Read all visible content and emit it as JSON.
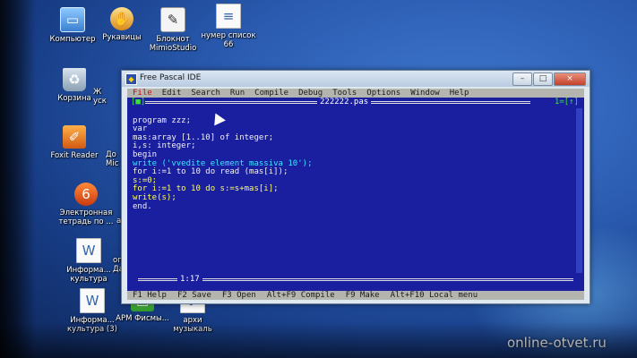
{
  "desktop": {
    "icons": [
      {
        "label": "Компьютер",
        "icon": "computer-icon"
      },
      {
        "label": "Рукавицы",
        "icon": "gloves-icon"
      },
      {
        "label": "Блокнот MimioStudio",
        "icon": "notepad-icon"
      },
      {
        "label": "нумер список 66",
        "icon": "document-icon"
      },
      {
        "label": "Корзина",
        "icon": "recycle-bin-icon"
      },
      {
        "label": "Ж",
        "icon": "partial-icon"
      },
      {
        "label": "уск",
        "icon": "partial-icon"
      },
      {
        "label": "Foxit Reader",
        "icon": "foxit-icon"
      },
      {
        "label": "До",
        "icon": "partial-icon"
      },
      {
        "label": "Mic",
        "icon": "partial-icon"
      },
      {
        "label": "Электронная тетрадь по ...",
        "icon": "ejournal-icon"
      },
      {
        "label": "ан",
        "icon": "partial-icon"
      },
      {
        "label": "Информа... культура",
        "icon": "document-icon"
      },
      {
        "label": "опи Дан",
        "icon": "partial-icon"
      },
      {
        "label": "Информа... культура (3)",
        "icon": "document-icon"
      },
      {
        "label": "АРМ Фисмы...",
        "icon": "green-app-icon"
      },
      {
        "label": "архи музыкаль",
        "icon": "document-icon"
      }
    ]
  },
  "window": {
    "title": "Free Pascal IDE",
    "buttons": {
      "minimize": "–",
      "maximize": "□",
      "close": "×"
    }
  },
  "ide": {
    "menu": [
      "File",
      "Edit",
      "Search",
      "Run",
      "Compile",
      "Debug",
      "Tools",
      "Options",
      "Window",
      "Help"
    ],
    "editor": {
      "filename": "222222.pas",
      "left_marker": "[■]",
      "right_marker": "1=[↑]",
      "position": "1:17"
    },
    "code_lines": [
      "program zzz;",
      "var",
      "mas:array [1..10] of integer;",
      "i,s: integer;",
      "begin",
      "write ('vvedite element massiva 10');",
      "for i:=1 to 10 do read (mas[i]);",
      "s:=0;",
      "for i:=1 to 10 do s:=s+mas[i];",
      "write(s);",
      "end."
    ],
    "status": [
      "F1 Help",
      "F2 Save",
      "F3 Open",
      "Alt+F9 Compile",
      "F9 Make",
      "Alt+F10 Local menu"
    ]
  },
  "watermark": "online-otvet.ru",
  "colors": {
    "ide_bg": "#1a1fa0",
    "ide_bar": "#b5b5b0",
    "hotkey": "#c01010",
    "desktop": "#2a5bb0"
  }
}
